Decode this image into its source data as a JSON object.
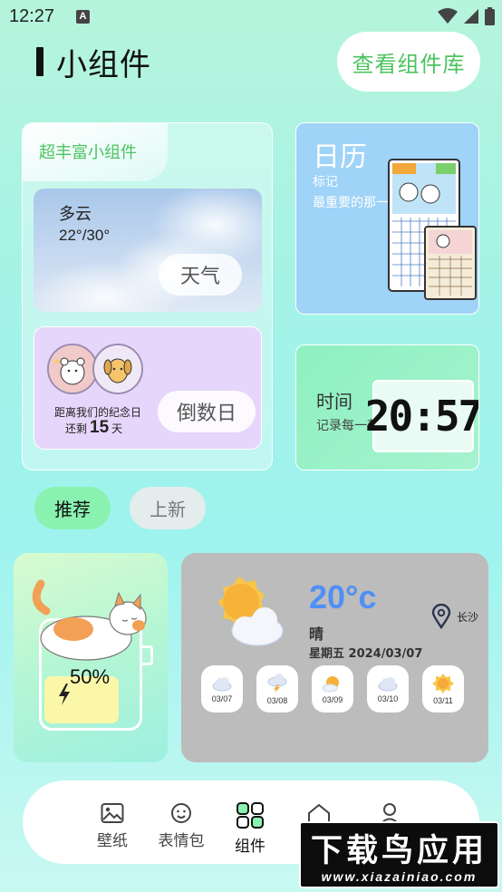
{
  "status_bar": {
    "time": "12:27",
    "notification_icon": "A",
    "icons": [
      "wifi-icon",
      "signal-icon",
      "battery-icon"
    ]
  },
  "header": {
    "title": "小组件",
    "library_button": "查看组件库"
  },
  "rich_widgets": {
    "label": "超丰富小组件",
    "weather": {
      "condition": "多云",
      "temp_range": "22°/30°",
      "button": "天气"
    },
    "countdown": {
      "caption": "距离我们的纪念日",
      "remain_prefix": "还剩",
      "days": "15",
      "unit": "天",
      "button": "倒数日"
    }
  },
  "calendar_widget": {
    "title": "日历",
    "subtitle_line1": "标记",
    "subtitle_line2": "最重要的那一天"
  },
  "time_widget": {
    "title": "时间",
    "subtitle": "记录每一刻",
    "clock": "20:57"
  },
  "filter_tabs": {
    "recommended": "推荐",
    "new": "上新"
  },
  "battery_widget": {
    "percent_label": "50%",
    "level": 0.5
  },
  "weather_widget": {
    "temperature": "20°c",
    "condition": "晴",
    "date_line": "星期五 2024/03/07",
    "city": "长沙",
    "forecast": [
      {
        "date": "03/07",
        "icon": "cloudy-icon"
      },
      {
        "date": "03/08",
        "icon": "thunderstorm-icon"
      },
      {
        "date": "03/09",
        "icon": "partly-sunny-icon"
      },
      {
        "date": "03/10",
        "icon": "cloudy-icon"
      },
      {
        "date": "03/11",
        "icon": "sunny-icon"
      }
    ]
  },
  "bottom_nav": {
    "wallpaper": "壁纸",
    "stickers": "表情包",
    "widgets": "组件"
  },
  "watermark": {
    "main": "下载鸟应用",
    "sub": "www.xiazainiao.com"
  },
  "colors": {
    "accent_green": "#4cc35f",
    "temp_blue": "#4f8ff7",
    "active_chip": "#8af2b0",
    "calendar_blue": "#9fd3f7",
    "countdown_purple": "#e6d6fb"
  }
}
